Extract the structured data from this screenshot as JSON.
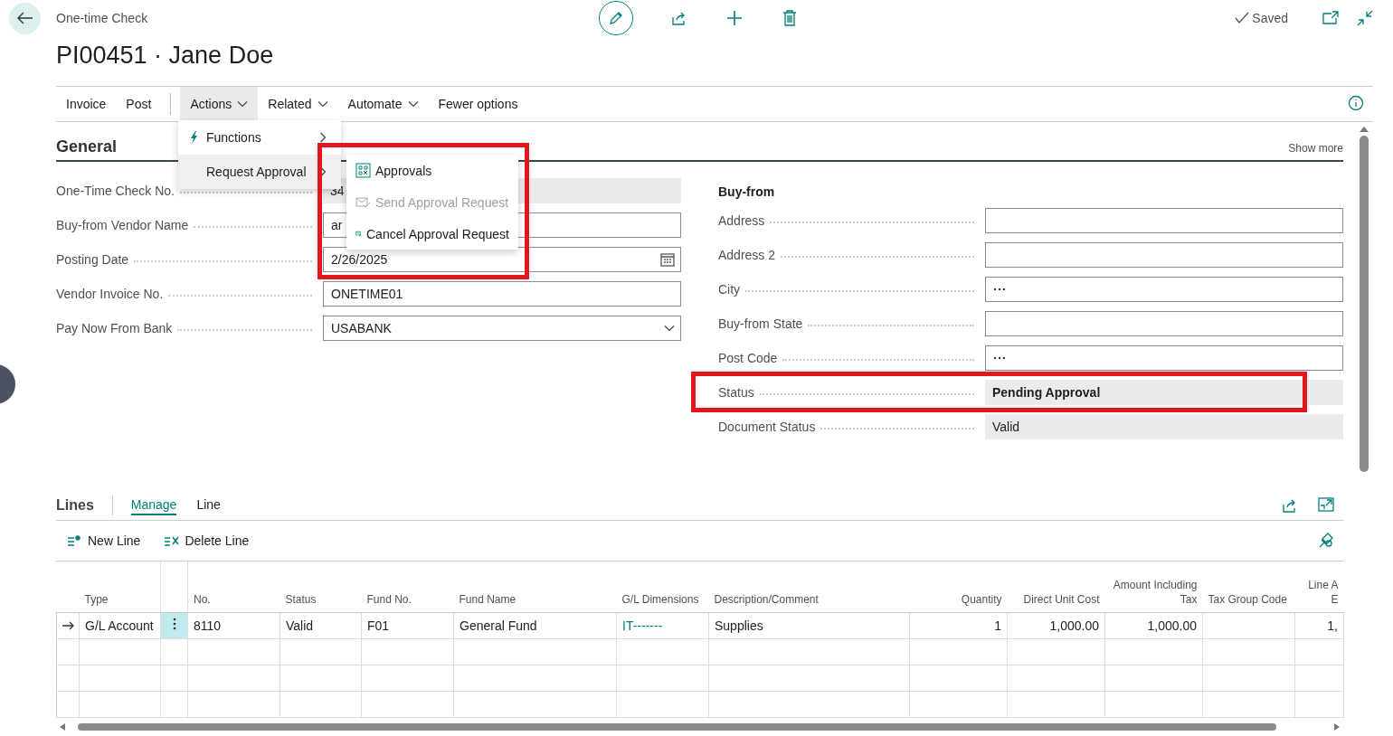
{
  "header": {
    "caption": "One-time Check",
    "title": "PI00451 · Jane Doe",
    "saved": "Saved"
  },
  "action_bar": {
    "items": [
      {
        "label": "Invoice",
        "has_menu": false,
        "selected": false
      },
      {
        "label": "Post",
        "has_menu": false,
        "selected": false
      },
      {
        "kind": "separator"
      },
      {
        "label": "Actions",
        "has_menu": true,
        "selected": true
      },
      {
        "label": "Related",
        "has_menu": true,
        "selected": false
      },
      {
        "label": "Automate",
        "has_menu": true,
        "selected": false
      },
      {
        "label": "Fewer options",
        "has_menu": false,
        "selected": false
      }
    ]
  },
  "menu": {
    "items": [
      {
        "label": "Functions",
        "selected": false
      },
      {
        "label": "Request Approval",
        "selected": true
      }
    ]
  },
  "submenu": {
    "items": [
      {
        "label": "Approvals",
        "disabled": false
      },
      {
        "label": "Send Approval Request",
        "disabled": true
      },
      {
        "label": "Cancel Approval Request",
        "disabled": false
      }
    ]
  },
  "general": {
    "title": "General",
    "show_more": "Show more",
    "left_fields": [
      {
        "label": "One-Time Check No.",
        "value": "34",
        "kind": "readonly"
      },
      {
        "label": "Buy-from Vendor Name",
        "value": "ar",
        "kind": "text"
      },
      {
        "label": "Posting Date",
        "value": "2/26/2025",
        "kind": "date"
      },
      {
        "label": "Vendor Invoice No.",
        "value": "ONETIME01",
        "kind": "text"
      },
      {
        "label": "Pay Now From Bank",
        "value": "USABANK",
        "kind": "dropdown"
      }
    ],
    "right_group": "Buy-from",
    "right_fields": [
      {
        "label": "Address",
        "kind": "text"
      },
      {
        "label": "Address 2",
        "kind": "text"
      },
      {
        "label": "City",
        "kind": "lookup"
      },
      {
        "label": "Buy-from State",
        "kind": "text"
      },
      {
        "label": "Post Code",
        "kind": "lookup"
      },
      {
        "label": "Status",
        "value": "Pending Approval",
        "kind": "readonly",
        "emphasized": true
      },
      {
        "label": "Document Status",
        "value": "Valid",
        "kind": "readonly",
        "emphasized": false
      }
    ]
  },
  "lines": {
    "title": "Lines",
    "tabs": [
      {
        "label": "Manage",
        "selected": true
      },
      {
        "label": "Line",
        "selected": false
      }
    ],
    "actions": [
      {
        "label": "New Line"
      },
      {
        "label": "Delete Line"
      }
    ],
    "table": {
      "columns": [
        {
          "label": "Type",
          "kind": "text"
        },
        {
          "label": "No.",
          "kind": "text"
        },
        {
          "label": "Status",
          "kind": "text"
        },
        {
          "label": "Fund No.",
          "kind": "text"
        },
        {
          "label": "Fund Name",
          "kind": "text"
        },
        {
          "label": "G/L Dimensions",
          "kind": "link"
        },
        {
          "label": "Description/Comment",
          "kind": "text"
        },
        {
          "label": "Quantity",
          "kind": "number"
        },
        {
          "label": "Direct Unit Cost",
          "kind": "number"
        },
        {
          "label": "Amount Including Tax",
          "kind": "number"
        },
        {
          "label": "Tax Group Code",
          "kind": "text"
        },
        {
          "label": "Line A E",
          "kind": "number"
        }
      ],
      "rows": [
        {
          "current": true,
          "cells": [
            "G/L Account",
            "8110",
            "Valid",
            "F01",
            "General Fund",
            "IT-------",
            "Supplies",
            "1",
            "1,000.00",
            "1,000.00",
            null,
            "1,"
          ]
        }
      ]
    }
  }
}
